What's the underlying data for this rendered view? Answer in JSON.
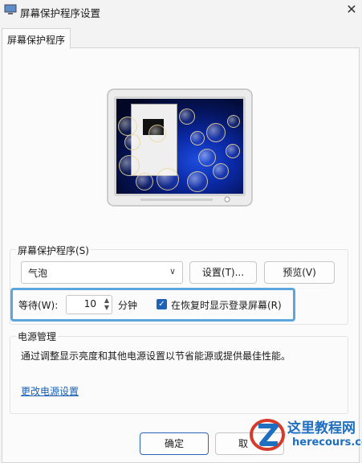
{
  "window": {
    "title": "屏幕保护程序设置",
    "close": "✕"
  },
  "tabs": [
    {
      "label": "屏幕保护程序"
    }
  ],
  "screensaver": {
    "group_label": "屏幕保护程序(S)",
    "selected": "气泡",
    "settings_button": "设置(T)...",
    "preview_button": "预览(V)",
    "wait_label": "等待(W):",
    "wait_value": "10",
    "wait_unit": "分钟",
    "resume_checkbox_label": "在恢复时显示登录屏幕(R)",
    "resume_checked": true
  },
  "power": {
    "group_label": "电源管理",
    "description": "通过调整显示亮度和其他电源设置以节省能源或提供最佳性能。",
    "link": "更改电源设置"
  },
  "footer": {
    "ok_button": "确定",
    "cancel_button_partial": "取"
  },
  "watermark": {
    "text": "这里教程网",
    "url": "herecours.com"
  },
  "colors": {
    "accent": "#1f63b8",
    "highlight": "#5aa6dd",
    "link": "#1a5fb4"
  }
}
